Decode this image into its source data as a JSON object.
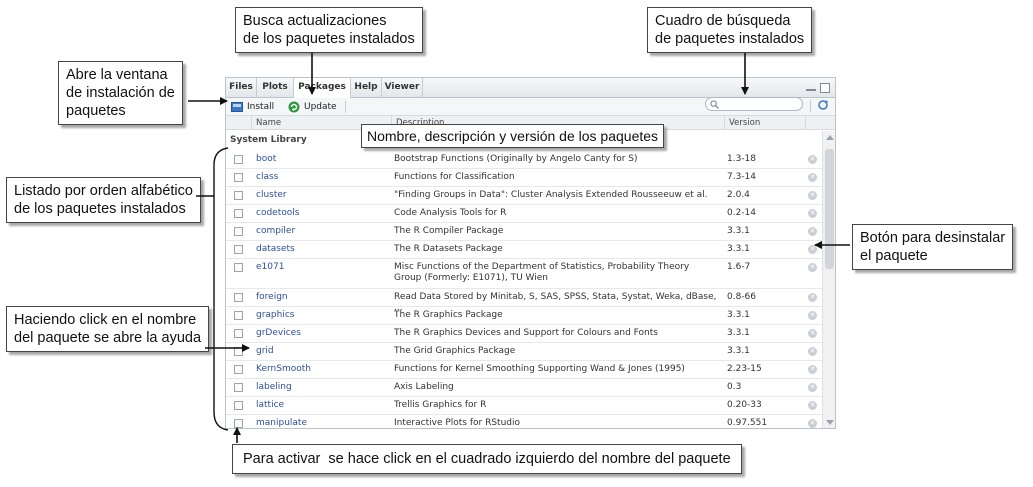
{
  "tabs": [
    {
      "label": "Files",
      "active": false
    },
    {
      "label": "Plots",
      "active": false
    },
    {
      "label": "Packages",
      "active": true
    },
    {
      "label": "Help",
      "active": false
    },
    {
      "label": "Viewer",
      "active": false
    }
  ],
  "toolbar": {
    "install_label": "Install",
    "update_label": "Update",
    "search_placeholder": ""
  },
  "columns": {
    "name": "Name",
    "description": "Description",
    "version": "Version"
  },
  "section_title": "System Library",
  "packages": [
    {
      "name": "boot",
      "description": "Bootstrap Functions (Originally by Angelo Canty for S)",
      "version": "1.3-18"
    },
    {
      "name": "class",
      "description": "Functions for Classification",
      "version": "7.3-14"
    },
    {
      "name": "cluster",
      "description": "\"Finding Groups in Data\": Cluster Analysis Extended Rousseeuw et al.",
      "version": "2.0.4"
    },
    {
      "name": "codetools",
      "description": "Code Analysis Tools for R",
      "version": "0.2-14"
    },
    {
      "name": "compiler",
      "description": "The R Compiler Package",
      "version": "3.3.1"
    },
    {
      "name": "datasets",
      "description": "The R Datasets Package",
      "version": "3.3.1"
    },
    {
      "name": "e1071",
      "description": "Misc Functions of the Department of Statistics, Probability Theory Group (Formerly: E1071), TU Wien",
      "version": "1.6-7"
    },
    {
      "name": "foreign",
      "description": "Read Data Stored by Minitab, S, SAS, SPSS, Stata, Systat, Weka, dBase, ...",
      "version": "0.8-66"
    },
    {
      "name": "graphics",
      "description": "The R Graphics Package",
      "version": "3.3.1"
    },
    {
      "name": "grDevices",
      "description": "The R Graphics Devices and Support for Colours and Fonts",
      "version": "3.3.1"
    },
    {
      "name": "grid",
      "description": "The Grid Graphics Package",
      "version": "3.3.1"
    },
    {
      "name": "KernSmooth",
      "description": "Functions for Kernel Smoothing Supporting Wand & Jones (1995)",
      "version": "2.23-15"
    },
    {
      "name": "labeling",
      "description": "Axis Labeling",
      "version": "0.3"
    },
    {
      "name": "lattice",
      "description": "Trellis Graphics for R",
      "version": "0.20-33"
    },
    {
      "name": "manipulate",
      "description": "Interactive Plots for RStudio",
      "version": "0.97.551"
    }
  ],
  "annotations": {
    "update": "Busca actualizaciones\nde los paquetes instalados",
    "search": "Cuadro de búsqueda\nde paquetes instalados",
    "install": "Abre la ventana\nde instalación de\npaquetes",
    "columns": "Nombre, descripción y versión de los paquetes",
    "alphabetical": "Listado por orden alfabético\nde los paquetes instalados",
    "uninstall": "Botón para desinstalar\nel paquete",
    "help": "Haciendo click en el nombre\ndel paquete se abre la ayuda",
    "activate": "Para activar  se hace click en el cuadrado izquierdo del nombre del paquete"
  },
  "colors": {
    "link": "#2c4fa0",
    "install_icon": "#3b78c2",
    "update_icon": "#2e9a3e"
  }
}
